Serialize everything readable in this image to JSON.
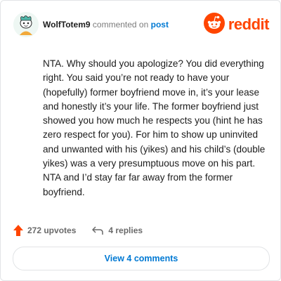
{
  "header": {
    "username": "WolfTotem9",
    "commented_text": "commented on",
    "post_link": "post",
    "logo_text": "reddit"
  },
  "comment": {
    "body": "NTA. Why should you apologize? You did everything right. You said you’re not ready to have your (hopefully) former boyfriend move in, it’s your lease and honestly it’s your life. The former boyfriend just showed you how much he respects you (hint he has zero respect for you). For him to show up uninvited and unwanted with his (yikes) and his child’s (double yikes) was a very presumptuous move on his part. NTA and I’d stay far far away from the former boyfriend."
  },
  "actions": {
    "upvotes": "272 upvotes",
    "replies": "4 replies"
  },
  "footer": {
    "view_comments": "View 4 comments"
  },
  "colors": {
    "brand": "#ff4500",
    "link": "#0079d3",
    "text": "#1c1c1c",
    "muted": "#6a6a6a"
  },
  "icons": {
    "avatar": "snoo-avatar-icon",
    "logo": "reddit-snoo-icon",
    "upvote": "upvote-arrow-icon",
    "reply": "reply-arrow-icon"
  }
}
